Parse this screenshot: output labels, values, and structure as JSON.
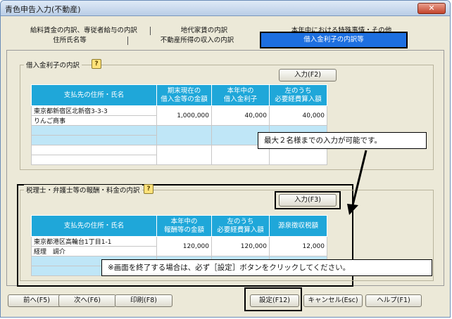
{
  "window": {
    "title": "青色申告入力(不動産)",
    "close_label": "✕"
  },
  "tabs": {
    "row1": [
      "給料賃金の内訳、専従者給与の内訳",
      "地代家賃の内訳",
      "本年中における特殊事情・その他"
    ],
    "row2": [
      "住所氏名等",
      "不動産所得の収入の内訳"
    ],
    "active": "借入金利子の内訳等"
  },
  "loan_section": {
    "title": "借入金利子の内訳",
    "input_button": "入力(F2)",
    "columns": [
      "支払先の住所・氏名",
      "期末現在の借入金等の金額",
      "本年中の借入金利子",
      "左のうち必要経費算入額"
    ],
    "columns_display": [
      [
        "支払先の住所・氏名"
      ],
      [
        "期末現在の",
        "借入金等の金額"
      ],
      [
        "本年中の",
        "借入金利子"
      ],
      [
        "左のうち",
        "必要経費算入額"
      ]
    ],
    "rows": [
      {
        "address": "東京都新宿区北新宿3-3-3",
        "name": "りんご商事",
        "balance": "1,000,000",
        "interest": "40,000",
        "expense": "40,000"
      }
    ]
  },
  "fee_section": {
    "title": "税理士・弁護士等の報酬・料金の内訳",
    "input_button": "入力(F3)",
    "columns_display": [
      [
        "支払先の住所・氏名"
      ],
      [
        "本年中の",
        "報酬等の金額"
      ],
      [
        "左のうち",
        "必要経費算入額"
      ],
      [
        "源泉徴収税額"
      ]
    ],
    "rows": [
      {
        "address": "東京都港区高輪台1丁目1-1",
        "name": "経理　調介",
        "amount": "120,000",
        "expense": "120,000",
        "withholding": "12,000"
      }
    ]
  },
  "callouts": {
    "limit_note": "最大２名様までの入力が可能です。",
    "finish_note": "※画面を終了する場合は、必ず［設定］ボタンをクリックしてください。"
  },
  "footer": {
    "prev": "前へ(F5)",
    "next": "次へ(F6)",
    "print": "印刷(F8)",
    "settings": "設定(F12)",
    "cancel": "キャンセル(Esc)",
    "help": "ヘルプ(F1)"
  }
}
